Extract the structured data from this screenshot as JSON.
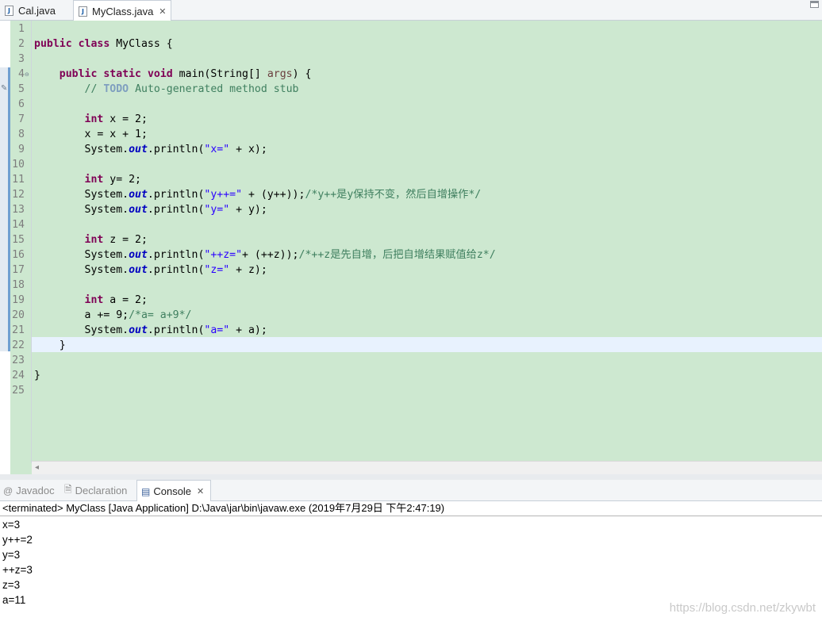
{
  "editor_tabs": [
    {
      "label": "Cal.java",
      "icon": "java-file-icon"
    },
    {
      "label": "MyClass.java",
      "icon": "java-file-icon",
      "close": "✕"
    }
  ],
  "java_badge": "J",
  "code_lines": [
    "",
    "public class MyClass {",
    "",
    "    public static void main(String[] args) {",
    "        // TODO Auto-generated method stub",
    "",
    "        int x = 2;",
    "        x = x + 1;",
    "        System.out.println(\"x=\" + x);",
    "",
    "        int y= 2;",
    "        System.out.println(\"y++=\" + (y++));/*y++是y保持不变，然后自增操作*/",
    "        System.out.println(\"y=\" + y);",
    "",
    "        int z = 2;",
    "        System.out.println(\"++z=\"+ (++z));/*++z是先自增，后把自增结果赋值给z*/",
    "        System.out.println(\"z=\" + z);",
    "",
    "        int a = 2;",
    "        a += 9;/*a= a+9*/",
    "        System.out.println(\"a=\" + a);",
    "    }",
    "",
    "}",
    ""
  ],
  "line_numbers": [
    "1",
    "2",
    "3",
    "4",
    "5",
    "6",
    "7",
    "8",
    "9",
    "10",
    "11",
    "12",
    "13",
    "14",
    "15",
    "16",
    "17",
    "18",
    "19",
    "20",
    "21",
    "22",
    "23",
    "24",
    "25"
  ],
  "view_tabs": [
    {
      "label": "Javadoc",
      "icon": "at-sign-icon",
      "glyph": "@"
    },
    {
      "label": "Declaration",
      "icon": "declaration-icon",
      "glyph": "🗎"
    },
    {
      "label": "Console",
      "icon": "console-icon",
      "glyph": "▤",
      "close": "✕"
    }
  ],
  "console": {
    "header": "<terminated> MyClass [Java Application] D:\\Java\\jar\\bin\\javaw.exe (2019年7月29日 下午2:47:19)",
    "output": [
      "x=3",
      "y++=2",
      "y=3",
      "++z=3",
      "z=3",
      "a=11"
    ]
  },
  "watermark": "https://blog.csdn.net/zkywbt",
  "colors": {
    "editor_background": "#cde8d0",
    "current_line": "#e8f2fe",
    "keyword": "#7f0055",
    "string": "#2a00ff",
    "comment": "#3f7f5f",
    "static_field": "#0000c0"
  }
}
